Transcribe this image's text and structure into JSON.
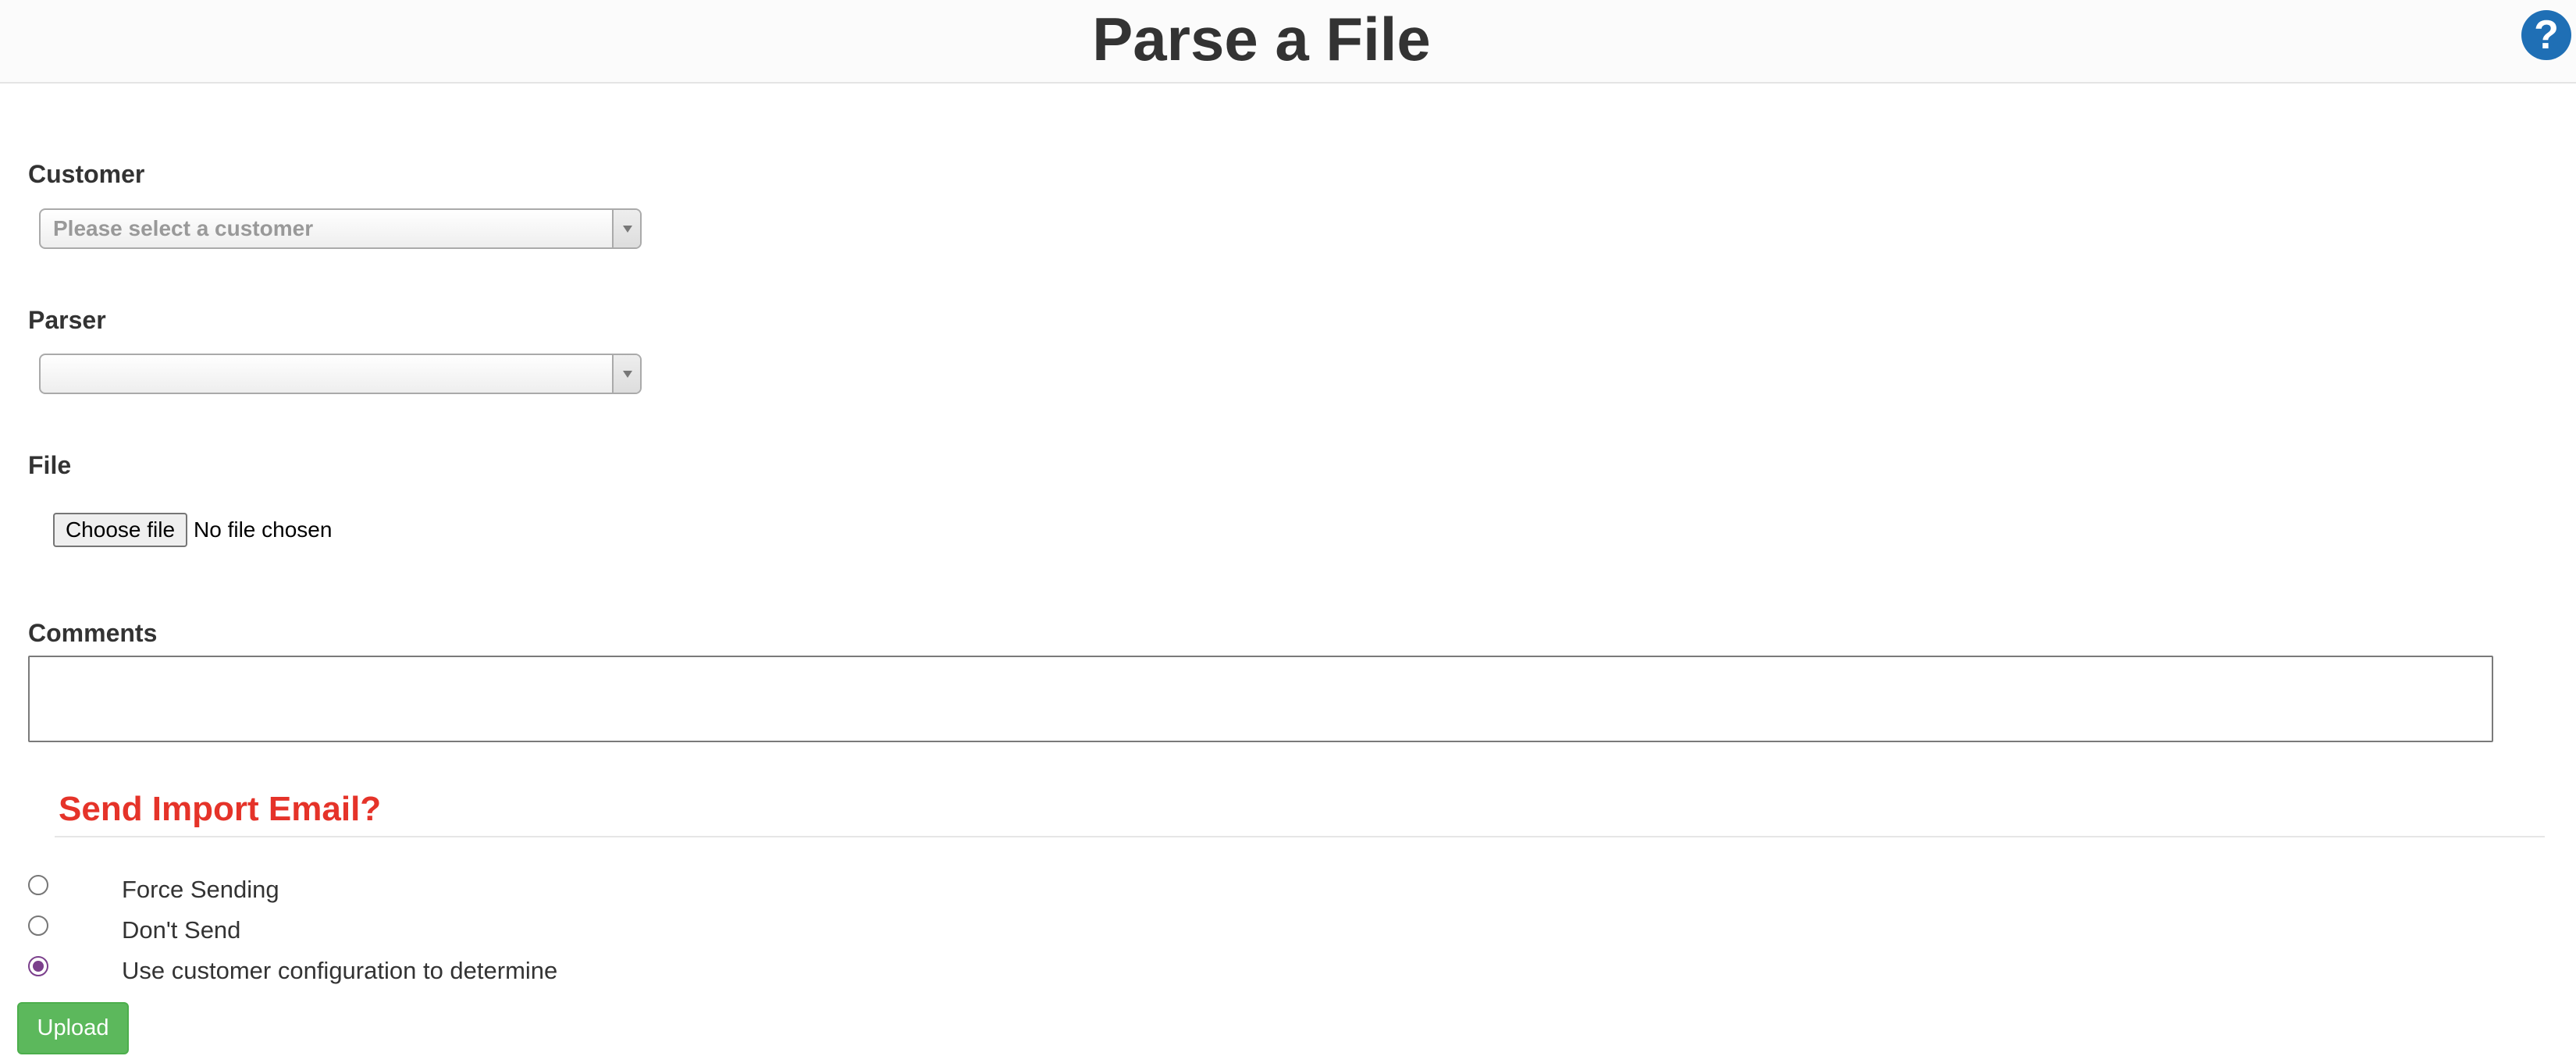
{
  "header": {
    "title": "Parse a File",
    "help_icon": "question-circle-icon",
    "help_glyph": "?"
  },
  "form": {
    "customer": {
      "label": "Customer",
      "placeholder": "Please select a customer"
    },
    "parser": {
      "label": "Parser",
      "value": ""
    },
    "file": {
      "label": "File",
      "button_label": "Choose file",
      "status": "No file chosen"
    },
    "comments": {
      "label": "Comments",
      "value": ""
    }
  },
  "email_section": {
    "title": "Send Import Email?",
    "title_color": "#e53329",
    "options": [
      {
        "label": "Force Sending",
        "checked": false
      },
      {
        "label": "Don't Send",
        "checked": false
      },
      {
        "label": "Use customer configuration to determine",
        "checked": true
      }
    ]
  },
  "actions": {
    "upload_label": "Upload",
    "upload_color": "#5cb85c"
  }
}
